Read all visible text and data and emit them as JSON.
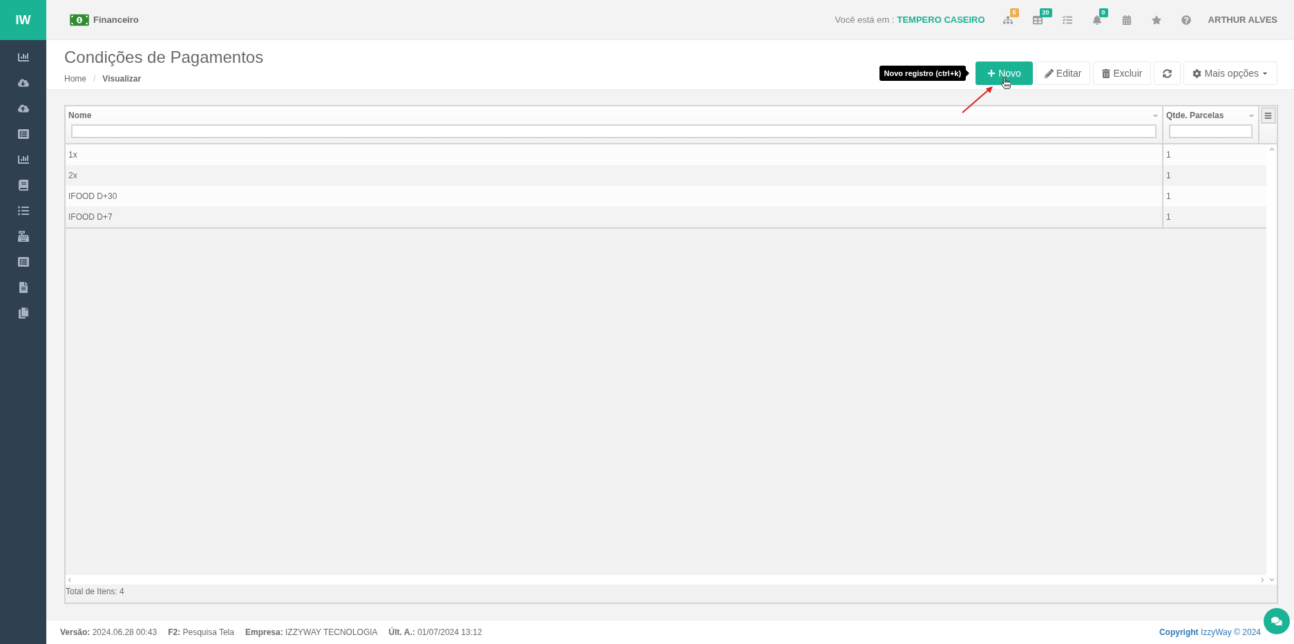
{
  "sidebar": {
    "logo": "IW"
  },
  "topbar": {
    "module": "Financeiro",
    "location_label": "Você está em :",
    "location": "TEMPERO CASEIRO",
    "badges": [
      {
        "text": "5",
        "color": "#f0ad4e"
      },
      {
        "text": "20",
        "color": "#1ab394"
      },
      {
        "text": "0",
        "color": "#1ab394"
      }
    ],
    "user": "ARTHUR ALVES"
  },
  "page": {
    "title": "Condições de Pagamentos",
    "breadcrumb_separator": "/",
    "breadcrumb": [
      {
        "label": "Home",
        "selected": false
      },
      {
        "label": "Visualizar",
        "selected": true
      }
    ]
  },
  "toolbar": {
    "tooltip": "Novo registro (ctrl+k)",
    "buttons": [
      {
        "kind": "primary",
        "label": "Novo"
      },
      {
        "kind": "edit",
        "label": "Editar"
      },
      {
        "kind": "delete",
        "label": "Excluir"
      },
      {
        "kind": "refresh"
      },
      {
        "kind": "more",
        "label": "Mais opções"
      }
    ]
  },
  "table": {
    "columns": [
      "Nome",
      "Qtde. Parcelas"
    ],
    "rows": [
      [
        "1x",
        "1"
      ],
      [
        "2x",
        "1"
      ],
      [
        "IFOOD D+30",
        "1"
      ],
      [
        "IFOOD D+7",
        "1"
      ]
    ],
    "total": "Total de Itens: 4"
  },
  "footer": {
    "items": [
      "**Versão:** 2024.06.28 00:43",
      "**F2:** Pesquisa Tela",
      "**Empresa:** IZZYWAY TECNOLOGIA",
      "**Últ. A.:** 01/07/2024 13:12"
    ],
    "copyright": "**Copyright** IzzyWay © 2024"
  }
}
